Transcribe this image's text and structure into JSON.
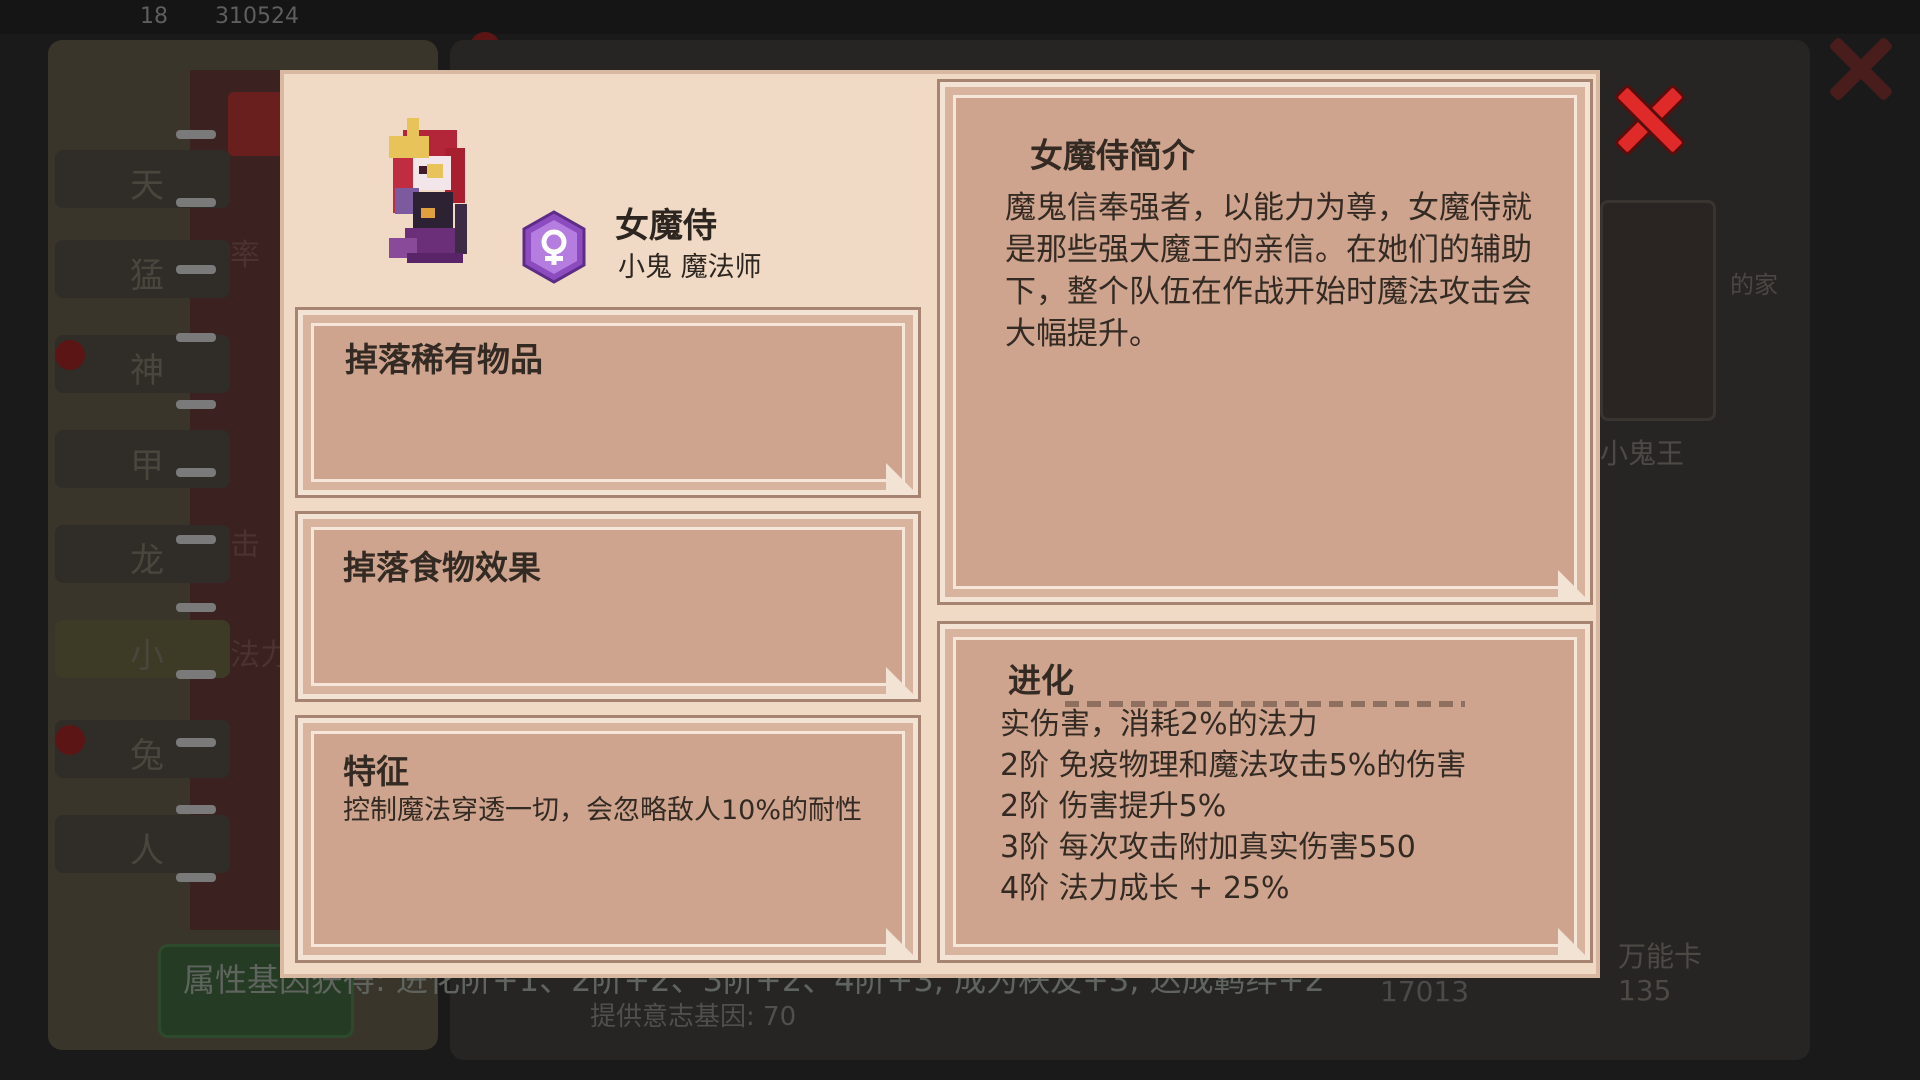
{
  "background": {
    "top_numbers": [
      "18",
      "310524"
    ],
    "side_tabs": [
      "天",
      "猛",
      "神",
      "甲",
      "龙",
      "小",
      "兔",
      "人"
    ],
    "strip_labels": [
      "率",
      "击",
      "法力"
    ],
    "right_card_label": "小鬼王",
    "right_side_text": "的家",
    "footer_button_text": "属性基因获得: 进化阶+1、2阶+2、3阶+2、4阶+3, 成为秩友+3, 达成羁绊+2",
    "footer_sub_text": "提供意志基因:  70",
    "card_label": "万能卡",
    "card_count": "135",
    "card_number": "17013"
  },
  "character": {
    "name": "女魔侍",
    "tags": "小鬼 魔法师",
    "gender_icon": "female-symbol-icon",
    "badge_color": "#8c4bbf"
  },
  "panels": {
    "drop_items_title": "掉落稀有物品",
    "drop_food_title": "掉落食物效果",
    "trait_title": "特征",
    "trait_text": "控制魔法穿透一切，会忽略敌人10%的耐性",
    "intro_title": "女魔侍简介",
    "intro_text": "魔鬼信奉强者，以能力为尊，女魔侍就是那些强大魔王的亲信。在她们的辅助下，整个队伍在作战开始时魔法攻击会大幅提升。",
    "evolve_title": "进化",
    "evolve_items": [
      "实伤害，消耗2%的法力",
      "2阶 免疫物理和魔法攻击5%的伤害",
      "2阶 伤害提升5%",
      "3阶 每次攻击附加真实伤害550",
      "4阶 法力成长 + 25%"
    ]
  },
  "colors": {
    "panel_fill": "#cfa48e",
    "modal_bg": "#f0d9c5",
    "close_red": "#e02a2a"
  }
}
